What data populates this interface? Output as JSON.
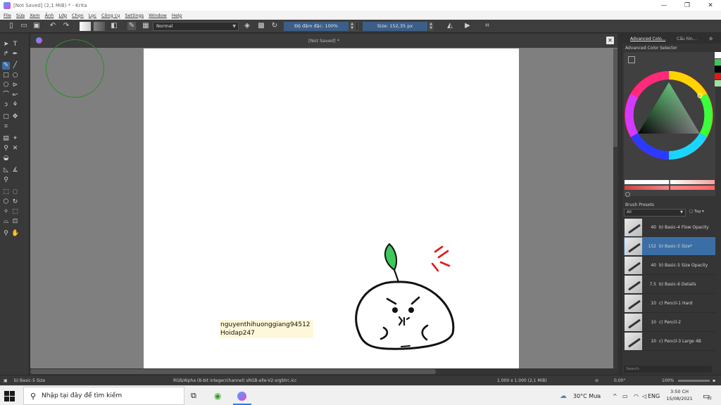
{
  "window": {
    "title": "[Not Saved]  (2,1 MiB)  * - Krita",
    "controls": {
      "minimize": "—",
      "maximize": "❐",
      "close": "✕"
    }
  },
  "menu": [
    "File",
    "Sửa",
    "Xem",
    "Ảnh",
    "Lớp",
    "Chọn",
    "Lọc",
    "Công cụ",
    "Settings",
    "Window",
    "Help"
  ],
  "toolbar": {
    "blending_mode": "Normal",
    "opacity_label": "Độ đậm đặc: 100%",
    "size_label": "Size: 152,35 px"
  },
  "document": {
    "tab_title": "[Not Saved]  *",
    "watermark_line1": "nguyenthihuonggiang94512",
    "watermark_line2": "Hoidap247"
  },
  "dockers": {
    "tabs": [
      "Advanced Colo...",
      "Cấu hìn...",
      "⚙"
    ],
    "color_selector_title": "Advanced Color Selector",
    "brush_presets_title": "Brush Presets",
    "filter_value": "All",
    "tag_label": "Tag",
    "search_placeholder": "Search",
    "presets": [
      {
        "size": "40",
        "name": "b) Basic-4 Flow Opacity",
        "selected": false
      },
      {
        "size": "152",
        "name": "b) Basic-5 Size*",
        "selected": true
      },
      {
        "size": "40",
        "name": "b) Basic-5 Size Opacity",
        "selected": false
      },
      {
        "size": "7.5",
        "name": "b) Basic-6 Details",
        "selected": false
      },
      {
        "size": "10",
        "name": "c) Pencil-1 Hard",
        "selected": false
      },
      {
        "size": "10",
        "name": "c) Pencil-2",
        "selected": false
      },
      {
        "size": "10",
        "name": "c) Pencil-3 Large 4B",
        "selected": false
      }
    ]
  },
  "status": {
    "current_brush": "b) Basic-5 Size",
    "color_info": "RGB/Alpha (8-bit integer/channel)  sRGB-elle-V2-srgbtrc.icc",
    "image_size": "1.000 x 1.000 (2,1 MiB)",
    "rotation": "0,00°",
    "zoom": "100%"
  },
  "taskbar": {
    "search_placeholder": "Nhập tại đây để tìm kiếm",
    "weather": "30°C  Mưa",
    "language": "ENG",
    "time": "3:50 CH",
    "date": "15/08/2021",
    "notification_count": "12"
  },
  "colors": {
    "accent": "#3b6ea5",
    "leaf": "#3cc85a",
    "anger_mark": "#e01818"
  }
}
